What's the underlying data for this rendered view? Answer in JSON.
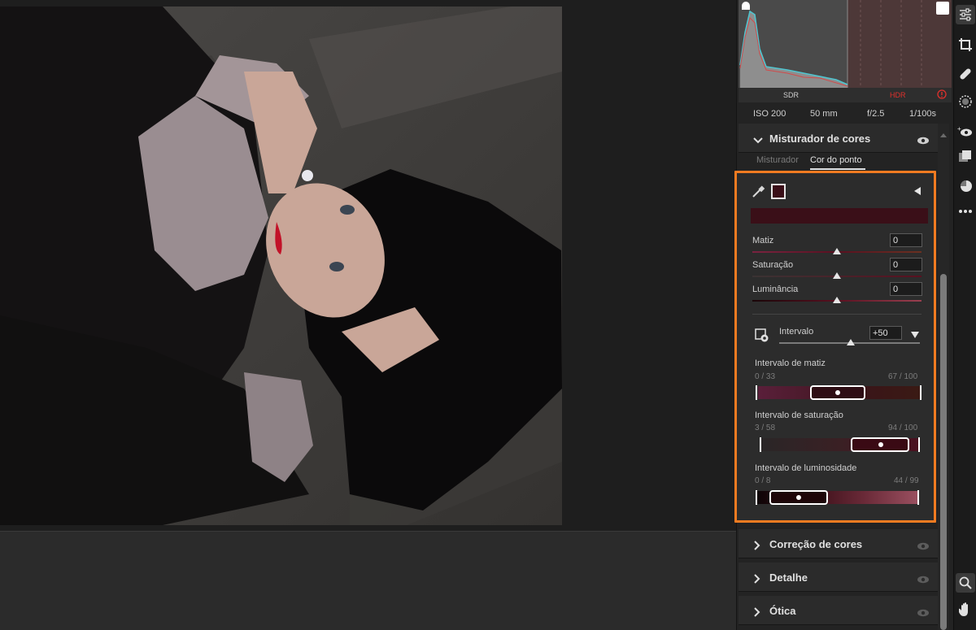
{
  "histogram": {
    "sdr_label": "SDR",
    "hdr_label": "HDR",
    "warning_icon": "warning-icon"
  },
  "exif": {
    "iso": "ISO 200",
    "focal": "50 mm",
    "aperture": "f/2.5",
    "shutter": "1/100s"
  },
  "mixer": {
    "title": "Misturador de cores",
    "tabs": [
      {
        "label": "Misturador",
        "active": false
      },
      {
        "label": "Cor do ponto",
        "active": true
      }
    ]
  },
  "spot": {
    "sample_color": "#3a0f18",
    "sliders": [
      {
        "label": "Matiz",
        "value": "0"
      },
      {
        "label": "Saturação",
        "value": "0"
      },
      {
        "label": "Luminância",
        "value": "0"
      }
    ],
    "range": {
      "label": "Intervalo",
      "value": "+50"
    },
    "hue_range": {
      "label": "Intervalo de matiz",
      "left": "0 / 33",
      "right": "67 / 100"
    },
    "sat_range": {
      "label": "Intervalo de saturação",
      "left": "3 / 58",
      "right": "94 / 100"
    },
    "lum_range": {
      "label": "Intervalo de luminosidade",
      "left": "0 / 8",
      "right": "44 / 99"
    }
  },
  "sections": [
    {
      "title": "Correção de cores"
    },
    {
      "title": "Detalhe"
    },
    {
      "title": "Ótica"
    }
  ],
  "colors": {
    "accent_outline": "#f27b21",
    "hdr_red": "#e0302c"
  }
}
